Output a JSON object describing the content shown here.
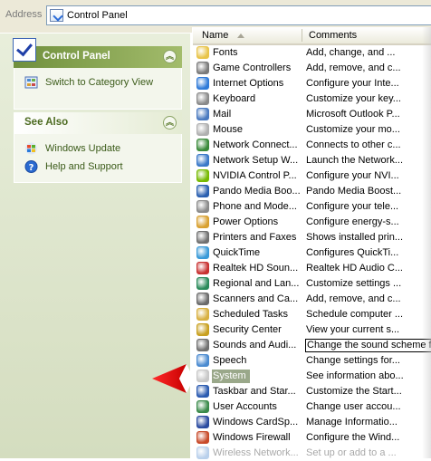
{
  "address_bar": {
    "label": "Address",
    "path": "Control Panel"
  },
  "task_pane": {
    "control_panel": {
      "title": "Control Panel",
      "switch_link": "Switch to Category View"
    },
    "see_also": {
      "title": "See Also",
      "links": [
        "Windows Update",
        "Help and Support"
      ]
    }
  },
  "list": {
    "headers": {
      "name": "Name",
      "comments": "Comments"
    },
    "items": [
      {
        "name": "Fonts",
        "comment": "Add, change, and ...",
        "color": "#e8c44a"
      },
      {
        "name": "Game Controllers",
        "comment": "Add, remove, and c...",
        "color": "#7a7a7a"
      },
      {
        "name": "Internet Options",
        "comment": "Configure your Inte...",
        "color": "#2f7ad8"
      },
      {
        "name": "Keyboard",
        "comment": "Customize your key...",
        "color": "#8a8a8a"
      },
      {
        "name": "Mail",
        "comment": "Microsoft Outlook P...",
        "color": "#4a7ac0"
      },
      {
        "name": "Mouse",
        "comment": "Customize your mo...",
        "color": "#b0b0b0"
      },
      {
        "name": "Network Connect...",
        "comment": "Connects to other c...",
        "color": "#3a8a3a"
      },
      {
        "name": "Network Setup W...",
        "comment": "Launch the Network...",
        "color": "#3a78c8"
      },
      {
        "name": "NVIDIA Control P...",
        "comment": "Configure your NVI...",
        "color": "#76b900"
      },
      {
        "name": "Pando Media Boo...",
        "comment": "Pando Media Boost...",
        "color": "#2a5fb0"
      },
      {
        "name": "Phone and Mode...",
        "comment": "Configure your tele...",
        "color": "#8a8a8a"
      },
      {
        "name": "Power Options",
        "comment": "Configure energy-s...",
        "color": "#d8a030"
      },
      {
        "name": "Printers and Faxes",
        "comment": "Shows installed prin...",
        "color": "#707070"
      },
      {
        "name": "QuickTime",
        "comment": "Configures QuickTi...",
        "color": "#3a9ad8"
      },
      {
        "name": "Realtek HD Soun...",
        "comment": "Realtek HD Audio C...",
        "color": "#c83030"
      },
      {
        "name": "Regional and Lan...",
        "comment": "Customize settings ...",
        "color": "#2a8a5a"
      },
      {
        "name": "Scanners and Ca...",
        "comment": "Add, remove, and c...",
        "color": "#6a6a6a"
      },
      {
        "name": "Scheduled Tasks",
        "comment": "Schedule computer ...",
        "color": "#d8b040"
      },
      {
        "name": "Security Center",
        "comment": "View your current s...",
        "color": "#c8a020"
      },
      {
        "name": "Sounds and Audi...",
        "comment": "Change the sound scheme f",
        "color": "#707070"
      },
      {
        "name": "Speech",
        "comment": "Change settings for...",
        "color": "#4a8ad0"
      },
      {
        "name": "System",
        "comment": "See information abo...",
        "color": "#9a9a9a"
      },
      {
        "name": "Taskbar and Star...",
        "comment": "Customize the Start...",
        "color": "#2a5ab0"
      },
      {
        "name": "User Accounts",
        "comment": "Change user accou...",
        "color": "#3a8a4a"
      },
      {
        "name": "Windows CardSp...",
        "comment": "Manage Informatio...",
        "color": "#2a4aa0"
      },
      {
        "name": "Windows Firewall",
        "comment": "Configure the Wind...",
        "color": "#c84a2a"
      },
      {
        "name": "Wireless Network...",
        "comment": "Set up or add to a ...",
        "color": "#3a7ac8"
      }
    ],
    "selected_item": "System",
    "tooltip_item": "Sounds and Audi..."
  },
  "colors": {
    "pointer": "#e01010",
    "task_pane_header": "#6f8f3c",
    "selection": "#9aa88a"
  }
}
